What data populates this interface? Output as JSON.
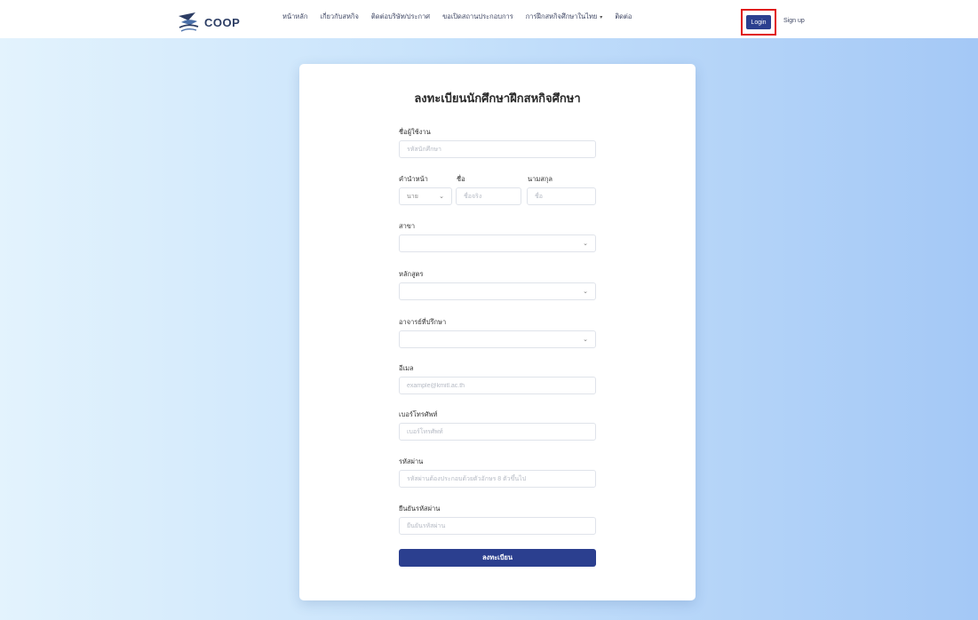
{
  "header": {
    "logo_text": "COOP",
    "nav": [
      {
        "label": "หน้าหลัก"
      },
      {
        "label": "เกี่ยวกับสหกิจ"
      },
      {
        "label": "ติดต่อบริษัท/ประกาศ"
      },
      {
        "label": "ขอเปิดสถานประกอบการ"
      },
      {
        "label": "การฝึกสหกิจศึกษาในไทย",
        "dropdown": true
      },
      {
        "label": "ติดต่อ"
      }
    ],
    "login_label": "Login",
    "signup_label": "Sign up"
  },
  "form": {
    "title": "ลงทะเบียนนักศึกษาฝึกสหกิจศึกษา",
    "username": {
      "label": "ชื่อผู้ใช้งาน",
      "placeholder": "รหัสนักศึกษา"
    },
    "prefix": {
      "label": "คำนำหน้า",
      "value": "นาย"
    },
    "firstname": {
      "label": "ชื่อ",
      "placeholder": "ชื่อจริง"
    },
    "lastname": {
      "label": "นามสกุล",
      "placeholder": "ชื่อ"
    },
    "major": {
      "label": "สาขา",
      "value": ""
    },
    "program": {
      "label": "หลักสูตร",
      "value": ""
    },
    "advisor": {
      "label": "อาจารย์ที่ปรึกษา",
      "value": ""
    },
    "email": {
      "label": "อีเมล",
      "placeholder": "example@kmitl.ac.th"
    },
    "phone": {
      "label": "เบอร์โทรศัพท์",
      "placeholder": "เบอร์โทรศัพท์"
    },
    "password": {
      "label": "รหัสผ่าน",
      "placeholder": "รหัสผ่านต้องประกอบด้วยตัวอักษร 8 ตัวขึ้นไป"
    },
    "confirm_password": {
      "label": "ยืนยันรหัสผ่าน",
      "placeholder": "ยืนยันรหัสผ่าน"
    },
    "submit_label": "ลงทะเบียน"
  },
  "colors": {
    "primary": "#2b3f8f",
    "highlight_frame": "#e01515"
  }
}
